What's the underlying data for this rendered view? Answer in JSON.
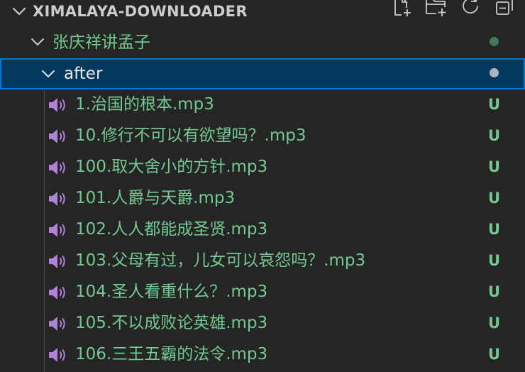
{
  "colors": {
    "background": "#252526",
    "untracked_text": "#73c991",
    "selected_bg": "#04395e",
    "selected_border": "#0078d4",
    "audio_icon": "#b180d7"
  },
  "explorer": {
    "title": "XIMALAYA-DOWNLOADER",
    "actions": [
      {
        "name": "new-file-icon"
      },
      {
        "name": "new-folder-icon"
      },
      {
        "name": "refresh-icon"
      },
      {
        "name": "collapse-all-icon"
      }
    ]
  },
  "tree": {
    "folder": {
      "label": "张庆祥讲孟子",
      "expanded": true
    },
    "subfolder": {
      "label": "after",
      "expanded": true,
      "selected": true
    },
    "files": [
      {
        "name": "1.治国的根本.mp3",
        "status": "U"
      },
      {
        "name": "10.修行不可以有欲望吗？.mp3",
        "status": "U"
      },
      {
        "name": "100.取大舍小的方针.mp3",
        "status": "U"
      },
      {
        "name": "101.人爵与天爵.mp3",
        "status": "U"
      },
      {
        "name": "102.人人都能成圣贤.mp3",
        "status": "U"
      },
      {
        "name": "103.父母有过，儿女可以哀怨吗？.mp3",
        "status": "U"
      },
      {
        "name": "104.圣人看重什么？.mp3",
        "status": "U"
      },
      {
        "name": "105.不以成败论英雄.mp3",
        "status": "U"
      },
      {
        "name": "106.三王五霸的法令.mp3",
        "status": "U"
      }
    ]
  }
}
